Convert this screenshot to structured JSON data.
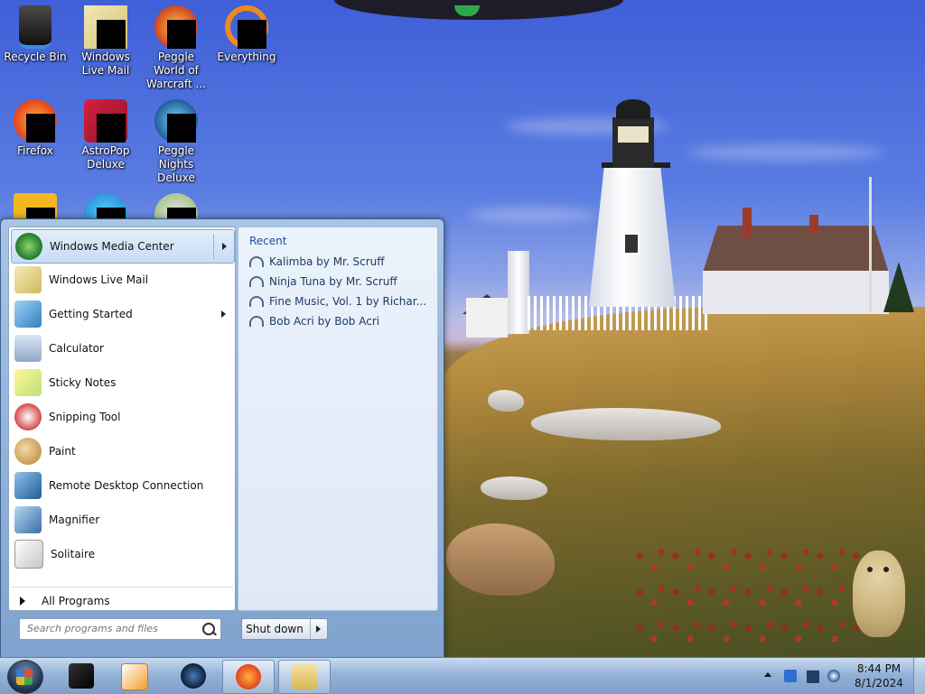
{
  "desktop": {
    "icons": [
      {
        "label": "Recycle Bin"
      },
      {
        "label": "Windows Live Mail"
      },
      {
        "label": "Peggle World of Warcraft ..."
      },
      {
        "label": "Everything"
      },
      {
        "label": "Firefox"
      },
      {
        "label": "AstroPop Deluxe"
      },
      {
        "label": "Peggle Nights Deluxe"
      }
    ]
  },
  "start_menu": {
    "programs": [
      {
        "label": "Windows Media Center",
        "icon": "windows-media-center-icon",
        "has_arrow": true,
        "selected": true
      },
      {
        "label": "Windows Live Mail",
        "icon": "windows-live-mail-icon"
      },
      {
        "label": "Getting Started",
        "icon": "getting-started-icon",
        "has_arrow": true
      },
      {
        "label": "Calculator",
        "icon": "calculator-icon"
      },
      {
        "label": "Sticky Notes",
        "icon": "sticky-notes-icon"
      },
      {
        "label": "Snipping Tool",
        "icon": "snipping-tool-icon"
      },
      {
        "label": "Paint",
        "icon": "paint-icon"
      },
      {
        "label": "Remote Desktop Connection",
        "icon": "remote-desktop-icon"
      },
      {
        "label": "Magnifier",
        "icon": "magnifier-icon"
      },
      {
        "label": "Solitaire",
        "icon": "solitaire-icon"
      }
    ],
    "all_programs": "All Programs",
    "search_placeholder": "Search programs and files",
    "shutdown": "Shut down",
    "recent": {
      "title": "Recent",
      "items": [
        {
          "label": "Kalimba by Mr. Scruff"
        },
        {
          "label": "Ninja Tuna by Mr. Scruff"
        },
        {
          "label": "Fine Music, Vol. 1 by Richar..."
        },
        {
          "label": "Bob Acri by Bob Acri"
        }
      ]
    }
  },
  "taskbar": {
    "clock_time": "8:44 PM",
    "clock_date": "8/1/2024"
  }
}
